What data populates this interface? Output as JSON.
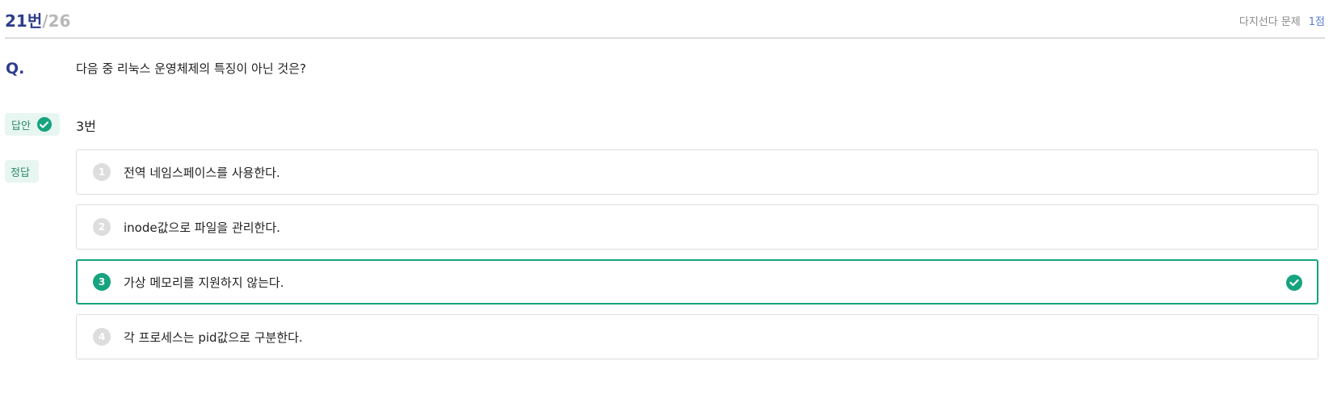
{
  "header": {
    "question_number": "21번",
    "question_total": "/26",
    "question_type": "다지선다 문제",
    "points": "1점"
  },
  "question": {
    "label": "Q.",
    "text": "다음 중 리눅스 운영체제의 특징이 아닌 것은?"
  },
  "answer": {
    "tag_label": "답안",
    "value": "3번"
  },
  "correct": {
    "tag_label": "정답"
  },
  "choices": [
    {
      "number": "1",
      "text": "전역 네임스페이스를 사용한다.",
      "selected": false
    },
    {
      "number": "2",
      "text": "inode값으로 파일을 관리한다.",
      "selected": false
    },
    {
      "number": "3",
      "text": "가상 메모리를 지원하지 않는다.",
      "selected": true
    },
    {
      "number": "4",
      "text": "각 프로세스는 pid값으로 구분한다.",
      "selected": false
    }
  ],
  "colors": {
    "primary": "#2e3d8c",
    "success": "#16a37f",
    "tag_bg": "#e8f6f1",
    "muted": "#8a8a8a"
  },
  "icons": {
    "answer_status": "check-circle-icon",
    "selected_choice": "check-circle-icon"
  }
}
